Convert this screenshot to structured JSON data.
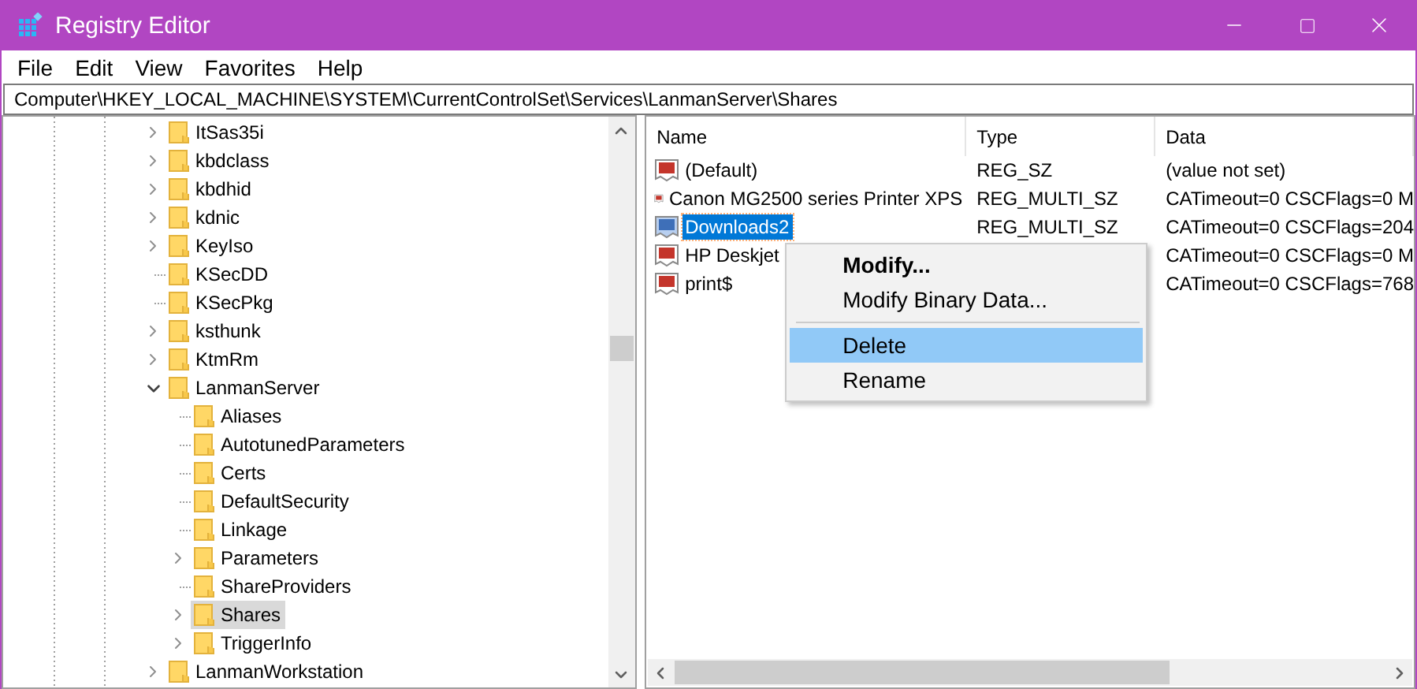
{
  "window": {
    "title": "Registry Editor"
  },
  "menu": [
    "File",
    "Edit",
    "View",
    "Favorites",
    "Help"
  ],
  "address": "Computer\\HKEY_LOCAL_MACHINE\\SYSTEM\\CurrentControlSet\\Services\\LanmanServer\\Shares",
  "tree": {
    "items": [
      {
        "label": "ItSas35i",
        "expandable": true,
        "expanded": false,
        "selected": false
      },
      {
        "label": "kbdclass",
        "expandable": true,
        "expanded": false,
        "selected": false
      },
      {
        "label": "kbdhid",
        "expandable": true,
        "expanded": false,
        "selected": false
      },
      {
        "label": "kdnic",
        "expandable": true,
        "expanded": false,
        "selected": false
      },
      {
        "label": "KeyIso",
        "expandable": true,
        "expanded": false,
        "selected": false
      },
      {
        "label": "KSecDD",
        "expandable": false,
        "selected": false
      },
      {
        "label": "KSecPkg",
        "expandable": false,
        "selected": false
      },
      {
        "label": "ksthunk",
        "expandable": true,
        "expanded": false,
        "selected": false
      },
      {
        "label": "KtmRm",
        "expandable": true,
        "expanded": false,
        "selected": false
      },
      {
        "label": "LanmanServer",
        "expandable": true,
        "expanded": true,
        "selected": false,
        "children": [
          {
            "label": "Aliases",
            "expandable": false,
            "selected": false
          },
          {
            "label": "AutotunedParameters",
            "expandable": false,
            "selected": false
          },
          {
            "label": "Certs",
            "expandable": false,
            "selected": false
          },
          {
            "label": "DefaultSecurity",
            "expandable": false,
            "selected": false
          },
          {
            "label": "Linkage",
            "expandable": false,
            "selected": false
          },
          {
            "label": "Parameters",
            "expandable": true,
            "expanded": false,
            "selected": false
          },
          {
            "label": "ShareProviders",
            "expandable": false,
            "selected": false
          },
          {
            "label": "Shares",
            "expandable": true,
            "expanded": false,
            "selected": true
          },
          {
            "label": "TriggerInfo",
            "expandable": true,
            "expanded": false,
            "selected": false
          }
        ]
      },
      {
        "label": "LanmanWorkstation",
        "expandable": true,
        "expanded": false,
        "selected": false
      }
    ]
  },
  "values": {
    "columns": [
      "Name",
      "Type",
      "Data"
    ],
    "rows": [
      {
        "name": "(Default)",
        "type": "REG_SZ",
        "data": "(value not set)",
        "selected": false
      },
      {
        "name": "Canon MG2500 series Printer XPS",
        "type": "REG_MULTI_SZ",
        "data": "CATimeout=0 CSCFlags=0 M",
        "selected": false
      },
      {
        "name": "Downloads2",
        "type": "REG_MULTI_SZ",
        "data": "CATimeout=0 CSCFlags=204",
        "selected": true
      },
      {
        "name": "HP Deskjet",
        "data": "CATimeout=0 CSCFlags=0 M",
        "selected": false
      },
      {
        "name": "print$",
        "data": "CATimeout=0 CSCFlags=768",
        "selected": false
      }
    ]
  },
  "context_menu": {
    "items": [
      {
        "kind": "item",
        "label": "Modify...",
        "default": true,
        "selected": false
      },
      {
        "kind": "item",
        "label": "Modify Binary Data...",
        "default": false,
        "selected": false
      },
      {
        "kind": "separator"
      },
      {
        "kind": "item",
        "label": "Delete",
        "default": false,
        "selected": true
      },
      {
        "kind": "item",
        "label": "Rename",
        "default": false,
        "selected": false
      }
    ]
  }
}
